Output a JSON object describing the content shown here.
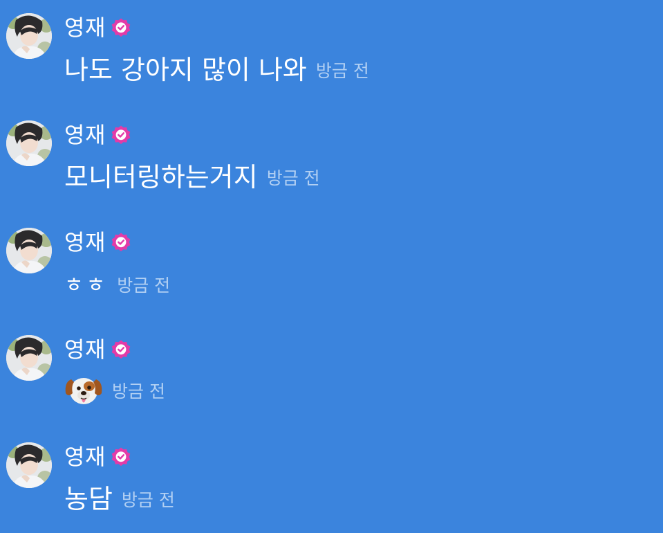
{
  "messages": [
    {
      "author": "영재",
      "text": "나도 강아지 많이 나와",
      "time": "방금 전"
    },
    {
      "author": "영재",
      "text": "모니터링하는거지",
      "time": "방금 전"
    },
    {
      "author": "영재",
      "text": "ㅎㅎ",
      "time": "방금 전"
    },
    {
      "author": "영재",
      "text": "",
      "emoji": "dog-face",
      "time": "방금 전"
    },
    {
      "author": "영재",
      "text": "농담",
      "time": "방금 전"
    }
  ],
  "colors": {
    "background": "#3b84dd",
    "name": "#ffffff",
    "timestamp": "#b2d0f3",
    "verified_badge": "#e33ba8"
  },
  "icons": {
    "verified": "verified-badge-icon",
    "avatar": "profile-avatar"
  }
}
